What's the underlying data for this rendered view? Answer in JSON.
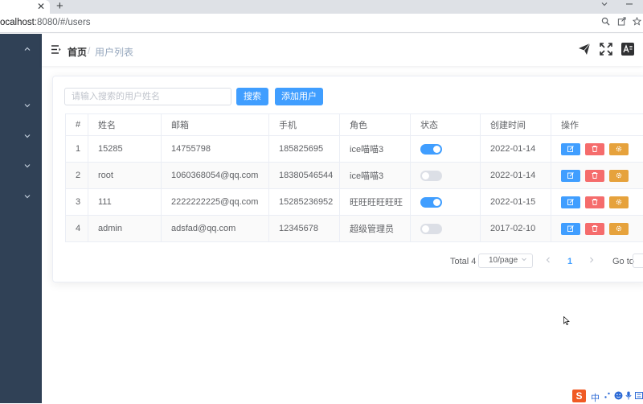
{
  "browser": {
    "tab_close": "✕",
    "new_tab": "+",
    "url_host": "ocalhost",
    "url_rest": ":8080/#/users"
  },
  "header": {
    "breadcrumb_home": "首页",
    "breadcrumb_sep": "/",
    "breadcrumb_current": "用户列表"
  },
  "toolbar": {
    "search_placeholder": "请输入搜索的用户姓名",
    "search_button": "搜索",
    "add_button": "添加用户"
  },
  "table": {
    "columns": [
      "#",
      "姓名",
      "邮箱",
      "手机",
      "角色",
      "状态",
      "创建时间",
      "操作"
    ],
    "rows": [
      {
        "index": "1",
        "name": "15285",
        "email": "14755798",
        "phone": "185825695",
        "role": "ice喵喵3",
        "status_on": true,
        "created": "2022-01-14"
      },
      {
        "index": "2",
        "name": "root",
        "email": "1060368054@qq.com",
        "phone": "18380546544",
        "role": "ice喵喵3",
        "status_on": false,
        "created": "2022-01-14"
      },
      {
        "index": "3",
        "name": "111",
        "email": "2222222225@qq.com",
        "phone": "15285236952",
        "role": "旺旺旺旺旺旺",
        "status_on": true,
        "created": "2022-01-15"
      },
      {
        "index": "4",
        "name": "admin",
        "email": "adsfad@qq.com",
        "phone": "12345678",
        "role": "超级管理员",
        "status_on": false,
        "created": "2017-02-10"
      }
    ]
  },
  "pagination": {
    "total": "Total 4",
    "page_size": "10/page",
    "current_page": "1",
    "goto": "Go to"
  },
  "ime": {
    "logo": "S",
    "lang": "中"
  },
  "colors": {
    "sidebar_bg": "#304156",
    "primary": "#409eff",
    "danger": "#f56c6c",
    "warning": "#e6a23c"
  }
}
